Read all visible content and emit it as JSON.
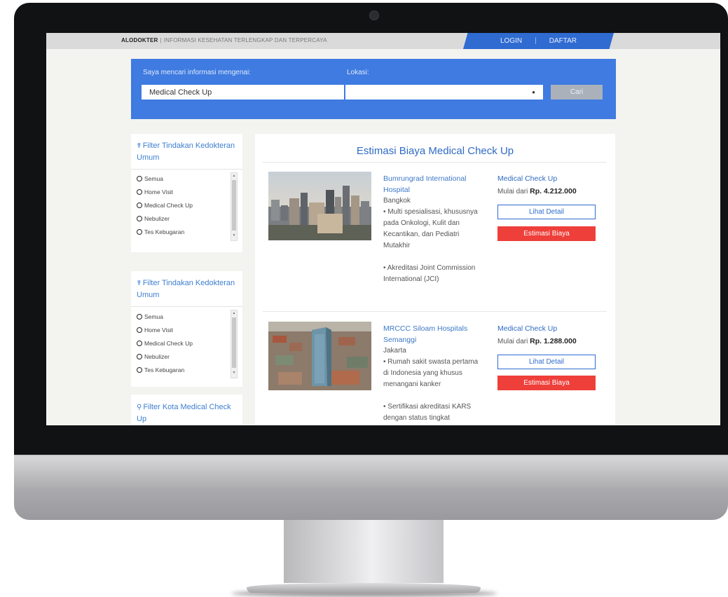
{
  "header": {
    "brand": "ALODOKTER",
    "separator": "|",
    "tagline": "INFORMASI KESEHATAN TERLENGKAP DAN TERPERCAYA",
    "login": "LOGIN",
    "nav_divider": "|",
    "register": "DAFTAR"
  },
  "search": {
    "label": "Saya mencari informasi mengenai:",
    "value": "Medical Check Up",
    "location_label": "Lokasi:",
    "location_value": "",
    "button": "Cari"
  },
  "filters": [
    {
      "title": "Filter Tindakan Kedokteran Umum",
      "options": [
        "Semua",
        "Home Visit",
        "Medical Check Up",
        "Nebulizer",
        "Tes Kebugaran"
      ]
    },
    {
      "title": "Filter Tindakan Kedokteran Umum",
      "options": [
        "Semua",
        "Home Visit",
        "Medical Check Up",
        "Nebulizer",
        "Tes Kebugaran"
      ]
    },
    {
      "title": "Filter Kota Medical Check Up",
      "options": []
    }
  ],
  "results": {
    "title": "Estimasi Biaya Medical Check Up",
    "items": [
      {
        "name": "Bumrungrad International Hospital",
        "city": "Bangkok",
        "bullets": [
          "• Multi spesialisasi, khususnya pada Onkologi, Kulit dan Kecantikan, dan Pediatri Mutakhir",
          "• Akreditasi Joint Commission International (JCI)"
        ],
        "service": "Medical Check Up",
        "price_prefix": "Mulai dari",
        "price": "Rp. 4.212.000",
        "detail_button": "Lihat Detail",
        "estimate_button": "Estimasi Biaya"
      },
      {
        "name": "MRCCC Siloam Hospitals Semanggi",
        "city": "Jakarta",
        "bullets": [
          "• Rumah sakit swasta pertama di Indonesia yang khusus menangani kanker",
          "• Sertifikasi akreditasi KARS dengan status tingkat"
        ],
        "service": "Medical Check Up",
        "price_prefix": "Mulai dari",
        "price": "Rp. 1.288.000",
        "detail_button": "Lihat Detail",
        "estimate_button": "Estimasi Biaya"
      }
    ]
  },
  "colors": {
    "brand_blue": "#3f7be0",
    "nav_blue": "#2f6bd1",
    "link_blue": "#3d78c7",
    "estimate_red": "#ee3f3a",
    "cari_grey": "#aab1bb"
  },
  "icons": [
    "stethoscope-icon",
    "map-pin-icon",
    "radio-icon",
    "dropdown-arrow-icon"
  ]
}
